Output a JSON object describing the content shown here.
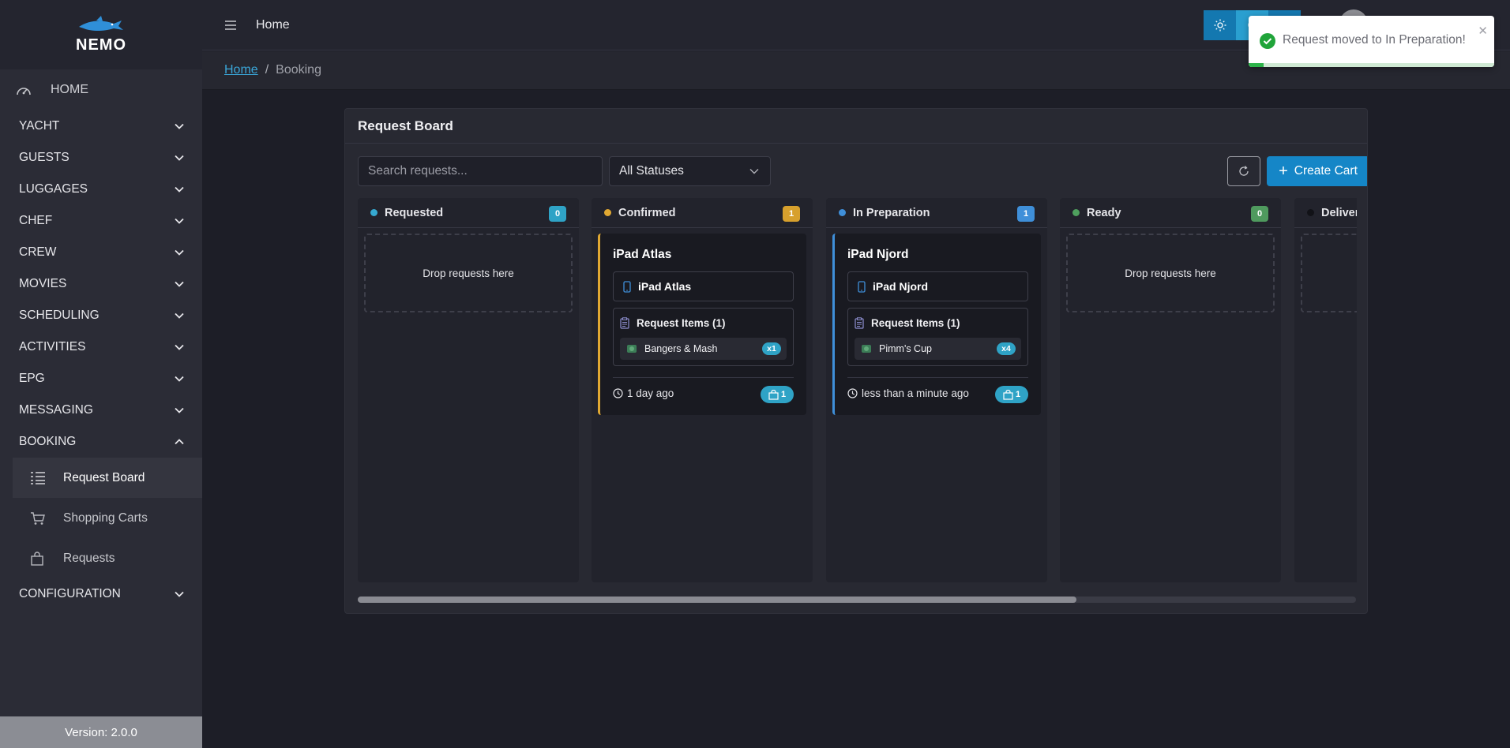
{
  "app": {
    "logo_text": "NEMO",
    "version": "Version: 2.0.0"
  },
  "sidebar": {
    "home": "HOME",
    "sections": [
      {
        "label": "YACHT",
        "expanded": false
      },
      {
        "label": "GUESTS",
        "expanded": false
      },
      {
        "label": "LUGGAGES",
        "expanded": false
      },
      {
        "label": "CHEF",
        "expanded": false
      },
      {
        "label": "CREW",
        "expanded": false
      },
      {
        "label": "MOVIES",
        "expanded": false
      },
      {
        "label": "SCHEDULING",
        "expanded": false
      },
      {
        "label": "ACTIVITIES",
        "expanded": false
      },
      {
        "label": "EPG",
        "expanded": false
      },
      {
        "label": "MESSAGING",
        "expanded": false
      },
      {
        "label": "BOOKING",
        "expanded": true
      }
    ],
    "booking_items": [
      {
        "label": "Request Board",
        "icon": "list-icon",
        "active": true
      },
      {
        "label": "Shopping Carts",
        "icon": "cart-icon",
        "active": false
      },
      {
        "label": "Requests",
        "icon": "bag-icon",
        "active": false
      }
    ],
    "configuration": "CONFIGURATION"
  },
  "topbar": {
    "title": "Home"
  },
  "breadcrumb": {
    "home": "Home",
    "separator": "/",
    "current": "Booking"
  },
  "board": {
    "title": "Request Board",
    "search_placeholder": "Search requests...",
    "status_filter": "All Statuses",
    "create_label": "Create Cart",
    "scroll_fraction": 0.72,
    "columns": [
      {
        "label": "Requested",
        "count": "0",
        "color": "#36a9d1",
        "drop_text": "Drop requests here"
      },
      {
        "label": "Confirmed",
        "count": "1",
        "color": "#e0a832",
        "card": {
          "title": "iPad Atlas",
          "device": "iPad Atlas",
          "items_label": "Request Items (1)",
          "item": "Bangers & Mash",
          "qty": "x1",
          "time": "1 day ago",
          "bag_count": "1",
          "accent": "#e0a832"
        }
      },
      {
        "label": "In Preparation",
        "count": "1",
        "color": "#3f8fd9",
        "card": {
          "title": "iPad Njord",
          "device": "iPad Njord",
          "items_label": "Request Items (1)",
          "item": "Pimm's Cup",
          "qty": "x4",
          "time": "less than a minute ago",
          "bag_count": "1",
          "accent": "#3f8fd9"
        }
      },
      {
        "label": "Ready",
        "count": "0",
        "color": "#4fa05e",
        "drop_text": "Drop requests here"
      },
      {
        "label": "Delivere",
        "color": "#111217"
      }
    ]
  },
  "toast": {
    "message": "Request moved to In Preparation!",
    "progress": 0.06
  }
}
